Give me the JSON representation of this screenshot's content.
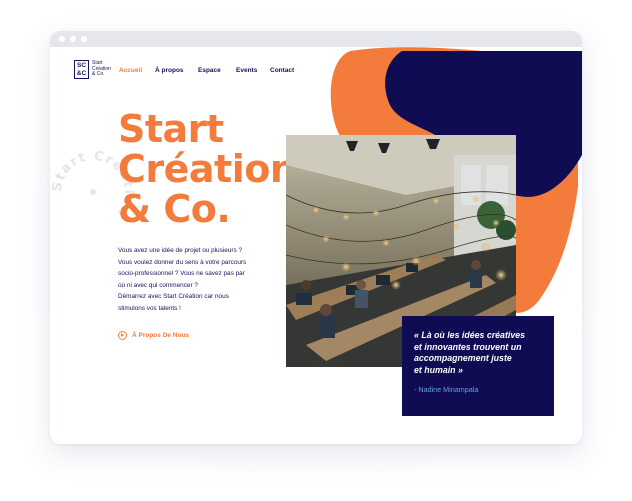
{
  "colors": {
    "accent": "#f37b3c",
    "navy": "#14145a",
    "quote_bg": "#100c54",
    "author": "#5aa0e6"
  },
  "logo": {
    "mark": [
      "SC",
      "&C"
    ],
    "text": [
      "Start",
      "Création",
      "& Co."
    ]
  },
  "nav": {
    "items": [
      {
        "label": "Accueil",
        "active": true
      },
      {
        "label": "À propos",
        "active": false
      },
      {
        "label": "Espace",
        "active": false
      },
      {
        "label": "Events",
        "active": false
      },
      {
        "label": "Contact",
        "active": false
      }
    ]
  },
  "hero": {
    "title_lines": [
      "Start",
      "Création",
      "& Co."
    ],
    "circle_text": "Start Création",
    "description_lines": [
      "Vous avez une idée de projet ou plusieurs ?",
      "Vous voulez donner du sens à votre parcours",
      "socio-professionnel ? Vous ne savez pas par",
      "où ni avec qui commencer ?",
      "Démarrez avec Start Création car nous",
      "stimulons vos talents !"
    ],
    "cta_label": "À Propos De Nous",
    "cta_icon": "play-circle-icon"
  },
  "quote": {
    "lines": [
      "« Là où les idées créatives",
      "et innovantes trouvent un",
      "accompagnement juste",
      "et humain »"
    ],
    "author": "- Nadine Minampala"
  }
}
